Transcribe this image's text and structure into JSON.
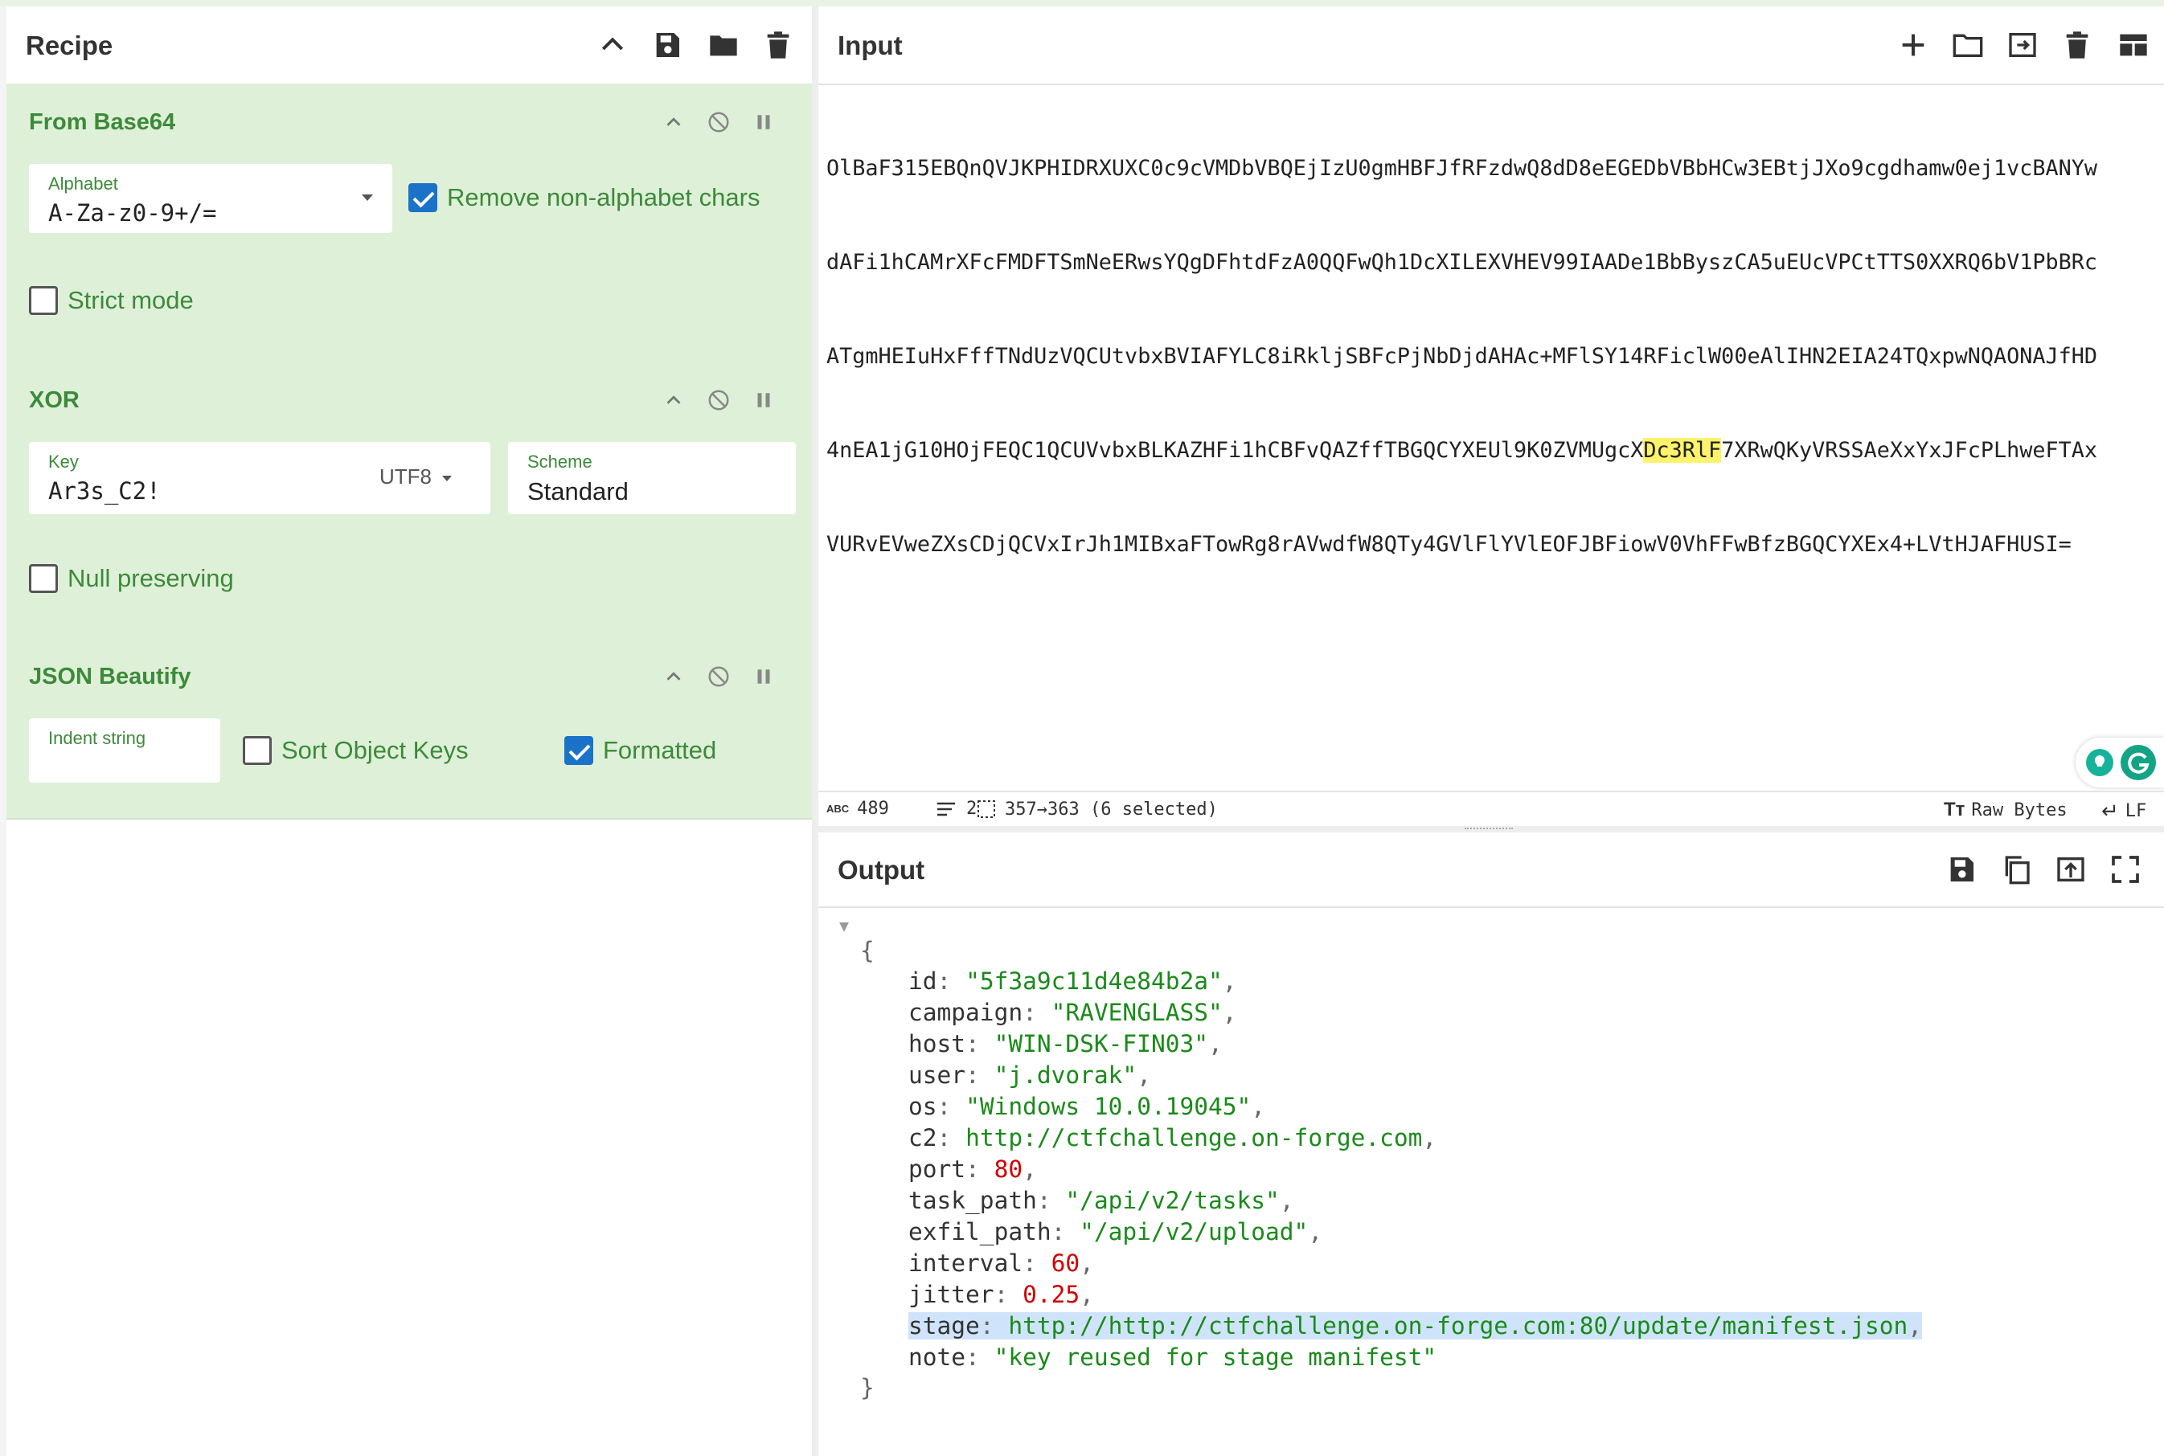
{
  "recipe": {
    "title": "Recipe",
    "header_icons": [
      "chevron-up-icon",
      "save-icon",
      "folder-icon",
      "trash-icon"
    ],
    "operations": [
      {
        "name": "From Base64",
        "alphabet_label": "Alphabet",
        "alphabet_value": "A-Za-z0-9+/=",
        "remove_non_alphabet_label": "Remove non-alphabet chars",
        "remove_non_alphabet_checked": true,
        "strict_mode_label": "Strict mode",
        "strict_mode_checked": false
      },
      {
        "name": "XOR",
        "key_label": "Key",
        "key_value": "Ar3s_C2!",
        "key_encoding": "UTF8",
        "scheme_label": "Scheme",
        "scheme_value": "Standard",
        "null_preserving_label": "Null preserving",
        "null_preserving_checked": false
      },
      {
        "name": "JSON Beautify",
        "indent_label": "Indent string",
        "indent_value": "",
        "sort_keys_label": "Sort Object Keys",
        "sort_keys_checked": false,
        "formatted_label": "Formatted",
        "formatted_checked": true
      }
    ]
  },
  "input": {
    "title": "Input",
    "header_icons": [
      "plus-icon",
      "folder-icon",
      "import-icon",
      "trash-icon",
      "layout-icon"
    ],
    "lines": [
      "OlBaF315EBQnQVJKPHIDRXUXC0c9cVMDbVBQEjIzU0gmHBFJfRFzdwQ8dD8eEGEDbVBbHCw3EBtjJXo9cgdhamw0ej1vcBANYw",
      "dAFi1hCAMrXFcFMDFTSmNeERwsYQgDFhtdFzA0QQFwQh1DcXILEXVHEV99IAADe1BbByszCA5uEUcVPCtTTS0XXRQ6bV1PbBRc",
      "ATgmHEIuHxFffTNdUzVQCUtvbxBVIAFYLC8iRkljSBFcPjNbDjdAHAc+MFlSY14RFiclW00eAlIHN2EIA24TQxpwNQAONAJfHD"
    ],
    "line4_before": "4nEA1jG10HOjFEQC1QCUVvbxBLKAZHFi1hCBFvQAZffTBGQCYXEUl9K0ZVMUgcX",
    "line4_highlight": "Dc3RlF",
    "line4_after": "7XRwQKyVRSSAeXxYxJFcPLhweFTAx",
    "line5": "VURvEVweZXsCDjQCVxIrJh1MIBxaFTowRg8rAVwdfW8QTy4GVlFlYVlEOFJBFiowV0VhFFwBfzBGQCYXEx4+LVtHJAFHUSI=",
    "status": {
      "length": "489",
      "lines": "2",
      "selection": "357→363 (6 selected)",
      "encoding": "Raw Bytes",
      "eol": "LF"
    }
  },
  "output": {
    "title": "Output",
    "header_icons": [
      "save-icon",
      "copy-icon",
      "replace-input-icon",
      "maximize-icon"
    ],
    "json": {
      "id": "\"5f3a9c11d4e84b2a\"",
      "campaign": "\"RAVENGLASS\"",
      "host": "\"WIN-DSK-FIN03\"",
      "user": "\"j.dvorak\"",
      "os": "\"Windows 10.0.19045\"",
      "c2": "http://ctfchallenge.on-forge.com",
      "port": "80",
      "task_path": "\"/api/v2/tasks\"",
      "exfil_path": "\"/api/v2/upload\"",
      "interval": "60",
      "jitter": "0.25",
      "stage": "http://http://ctfchallenge.on-forge.com:80/update/manifest.json",
      "note": "\"key reused for stage manifest\""
    }
  },
  "colors": {
    "operation_bg": "#dff0d8",
    "operation_text": "#3c8a3a",
    "checkbox_on": "#1a73c8",
    "json_string": "#1a8a1a",
    "json_number": "#d00000",
    "input_highlight": "#fff36b",
    "output_selection": "#cfe4fa"
  }
}
